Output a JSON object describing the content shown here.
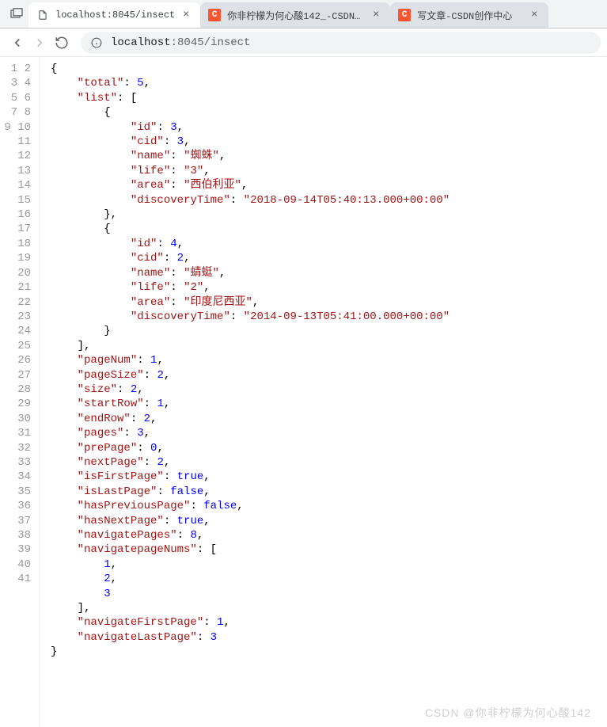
{
  "tabs": [
    {
      "title": "localhost:8045/insect",
      "active": true
    },
    {
      "title": "你非柠檬为何心酸142_-CSDN博客",
      "active": false
    },
    {
      "title": "写文章-CSDN创作中心",
      "active": false
    }
  ],
  "address": {
    "host": "localhost",
    "port": ":8045",
    "path": "/insect"
  },
  "watermark": "CSDN @你非柠檬为何心酸142",
  "json": {
    "total": 5,
    "list": [
      {
        "id": 3,
        "cid": 3,
        "name": "蜘蛛",
        "life": "3",
        "area": "西伯利亚",
        "discoveryTime": "2018-09-14T05:40:13.000+00:00"
      },
      {
        "id": 4,
        "cid": 2,
        "name": "蜻蜓",
        "life": "2",
        "area": "印度尼西亚",
        "discoveryTime": "2014-09-13T05:41:00.000+00:00"
      }
    ],
    "pageNum": 1,
    "pageSize": 2,
    "size": 2,
    "startRow": 1,
    "endRow": 2,
    "pages": 3,
    "prePage": 0,
    "nextPage": 2,
    "isFirstPage": true,
    "isLastPage": false,
    "hasPreviousPage": false,
    "hasNextPage": true,
    "navigatePages": 8,
    "navigatepageNums": [
      1,
      2,
      3
    ],
    "navigateFirstPage": 1,
    "navigateLastPage": 3
  }
}
